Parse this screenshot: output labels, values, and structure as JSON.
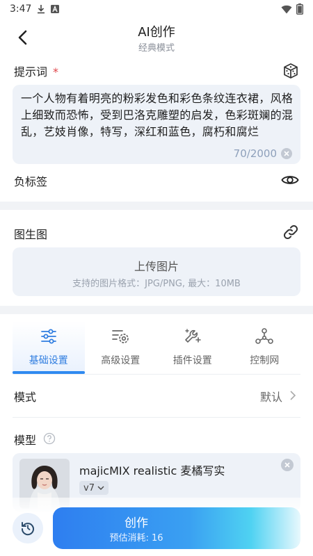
{
  "status_bar": {
    "time": "3:47",
    "icons": [
      "download-icon",
      "a-badge-icon",
      "wifi-icon",
      "battery-icon"
    ]
  },
  "header": {
    "title": "AI创作",
    "subtitle": "经典模式"
  },
  "prompt": {
    "label": "提示词",
    "required_mark": "*",
    "text": "一个人物有着明亮的粉彩发色和彩色条纹连衣裙，风格上细致而恐怖，受到巴洛克雕塑的启发，色彩斑斓的混乱，艺妓肖像，特写，深红和蓝色，腐朽和腐烂",
    "count": "70/2000"
  },
  "negative_prompt": {
    "label": "负标签"
  },
  "img2img": {
    "label": "图生图",
    "upload_title": "上传图片",
    "upload_hint": "支持的图片格式：JPG/PNG, 最大：10MB"
  },
  "tabs": [
    {
      "label": "基础设置",
      "icon": "sliders-icon",
      "active": true
    },
    {
      "label": "高级设置",
      "icon": "gear-settings-icon",
      "active": false
    },
    {
      "label": "插件设置",
      "icon": "wrench-sparkle-icon",
      "active": false
    },
    {
      "label": "控制网",
      "icon": "network-icon",
      "active": false
    }
  ],
  "mode": {
    "label": "模式",
    "value": "默认"
  },
  "model": {
    "label": "模型",
    "name": "majicMIX realistic 麦橘写实",
    "version": "v7"
  },
  "bottom": {
    "create_label": "创作",
    "cost_text": "预估消耗: 16"
  },
  "colors": {
    "accent": "#2f8af0",
    "panel": "#eef2f8",
    "required": "#e0464b"
  }
}
